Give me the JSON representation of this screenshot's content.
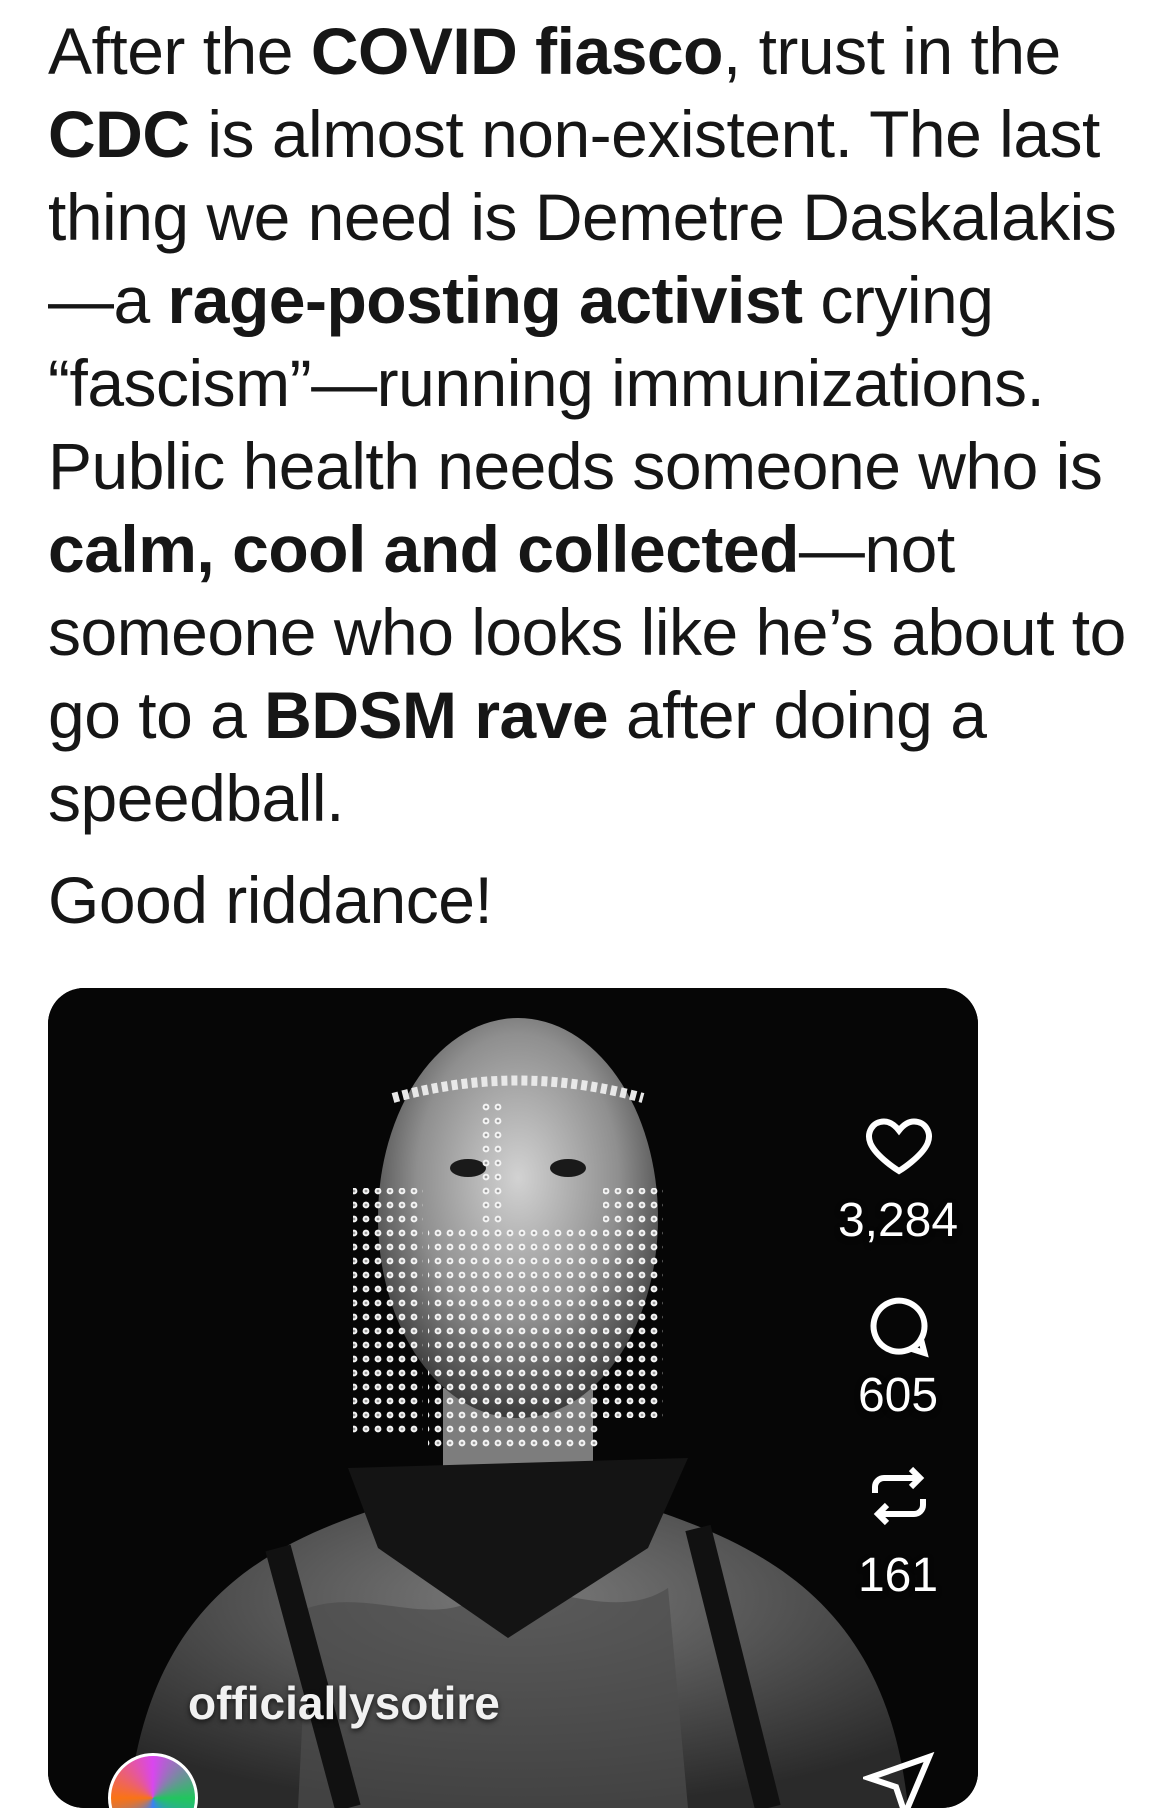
{
  "post": {
    "p1": {
      "s1": "After the ",
      "b1": "COVID fiasco",
      "s2": ", trust in the ",
      "b2": "CDC",
      "s3": " is almost non-existent. The last thing we need is Demetre Daskalakis—a ",
      "b3": "rage-posting activist",
      "s4": " crying “fascism”—running immunizations. Public health needs someone who is ",
      "b4": "calm, cool and collected",
      "s5": "—not someone who looks like he’s about to go to a ",
      "b5": "BDSM rave",
      "s6": " after doing a speedball."
    },
    "p2": "Good riddance!"
  },
  "media": {
    "likes": "3,284",
    "comments": "605",
    "reposts": "161",
    "username": "officiallysotire",
    "icons": [
      "heart-icon",
      "comment-icon",
      "repost-icon",
      "send-icon"
    ],
    "colors": {
      "overlay_text": "#ffffff",
      "background": "#050505"
    }
  }
}
